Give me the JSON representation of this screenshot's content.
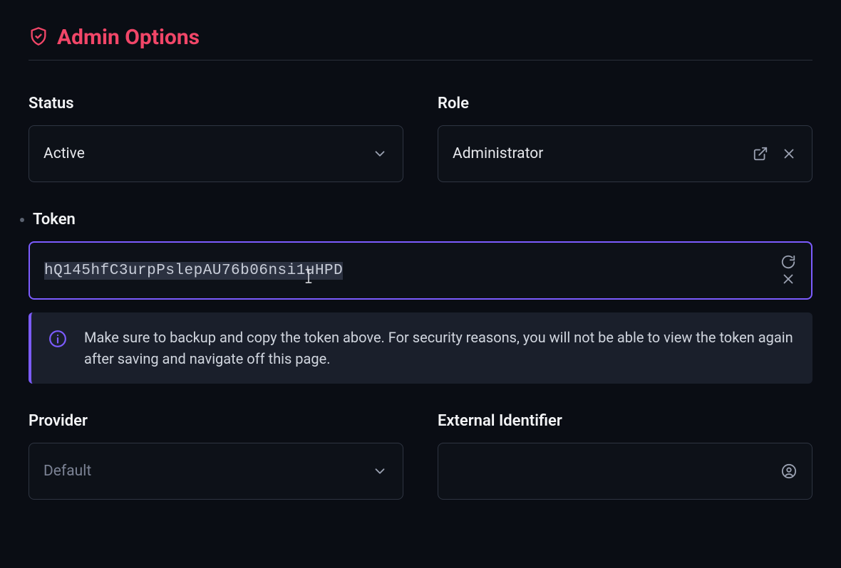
{
  "header": {
    "title": "Admin Options"
  },
  "fields": {
    "status": {
      "label": "Status",
      "value": "Active"
    },
    "role": {
      "label": "Role",
      "value": "Administrator"
    },
    "token": {
      "label": "Token",
      "value": "hQ145hfC3urpPslepAU76b06nsi1uHPD",
      "info": "Make sure to backup and copy the token above. For security reasons, you will not be able to view the token again after saving and navigate off this page."
    },
    "provider": {
      "label": "Provider",
      "value": "Default"
    },
    "external_identifier": {
      "label": "External Identifier",
      "value": ""
    }
  }
}
